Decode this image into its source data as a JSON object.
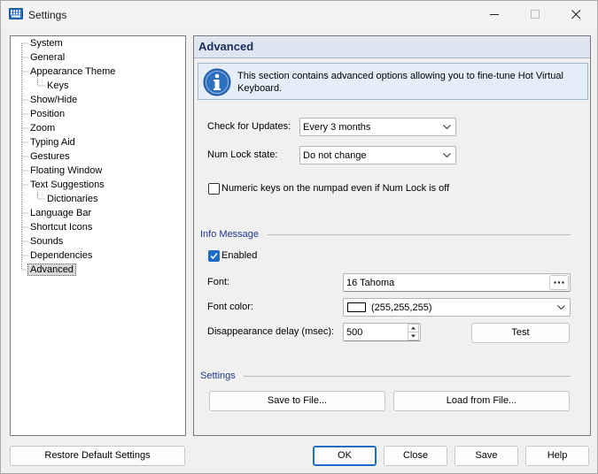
{
  "window": {
    "title": "Settings"
  },
  "tree": {
    "items": [
      {
        "label": "System",
        "level": 0
      },
      {
        "label": "General",
        "level": 0
      },
      {
        "label": "Appearance Theme",
        "level": 0
      },
      {
        "label": "Keys",
        "level": 1
      },
      {
        "label": "Show/Hide",
        "level": 0
      },
      {
        "label": "Position",
        "level": 0
      },
      {
        "label": "Zoom",
        "level": 0
      },
      {
        "label": "Typing Aid",
        "level": 0
      },
      {
        "label": "Gestures",
        "level": 0
      },
      {
        "label": "Floating Window",
        "level": 0
      },
      {
        "label": "Text Suggestions",
        "level": 0
      },
      {
        "label": "Dictionaries",
        "level": 1
      },
      {
        "label": "Language Bar",
        "level": 0
      },
      {
        "label": "Shortcut Icons",
        "level": 0
      },
      {
        "label": "Sounds",
        "level": 0
      },
      {
        "label": "Dependencies",
        "level": 0
      },
      {
        "label": "Advanced",
        "level": 0,
        "selected": true
      }
    ]
  },
  "panel": {
    "title": "Advanced",
    "info_text": "This section contains advanced options allowing you to fine-tune Hot Virtual Keyboard.",
    "check_updates_label": "Check for Updates:",
    "check_updates_value": "Every 3 months",
    "num_lock_label": "Num Lock state:",
    "num_lock_value": "Do not change",
    "numeric_keys_label": "Numeric keys on the numpad even if Num Lock is off",
    "numeric_keys_checked": false,
    "info_message_section": "Info Message",
    "enabled_label": "Enabled",
    "enabled_checked": true,
    "font_label": "Font:",
    "font_value": "16 Tahoma",
    "font_color_label": "Font color:",
    "font_color_value": "(255,255,255)",
    "font_color_swatch": "#ffffff",
    "delay_label": "Disappearance delay (msec):",
    "delay_value": "500",
    "test_button": "Test",
    "settings_section": "Settings",
    "save_to_file_button": "Save to File...",
    "load_from_file_button": "Load from File..."
  },
  "footer": {
    "restore_button": "Restore Default Settings",
    "ok_button": "OK",
    "close_button": "Close",
    "save_button": "Save",
    "help_button": "Help"
  },
  "colors": {
    "accent": "#1f6cc6",
    "header_bg": "#dfe6f2",
    "section_title": "#1e3a8a"
  }
}
